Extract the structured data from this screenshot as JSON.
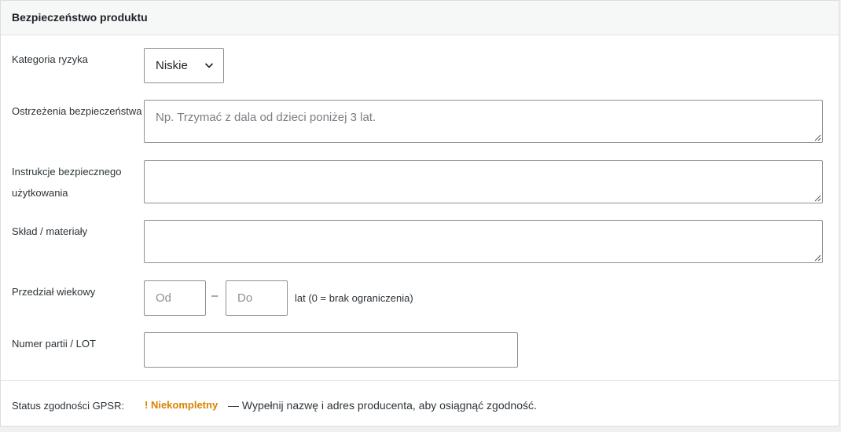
{
  "panel": {
    "title": "Bezpieczeństwo produktu"
  },
  "fields": {
    "risk_category": {
      "label": "Kategoria ryzyka",
      "value": "Niskie",
      "icon": "chevron-down-icon"
    },
    "safety_warnings": {
      "label": "Ostrzeżenia bezpieczeństwa",
      "value": "",
      "placeholder": "Np. Trzymać z dala od dzieci poniżej 3 lat."
    },
    "safe_use_instructions": {
      "label_line1": "Instrukcje bezpiecznego",
      "label_line2": "użytkowania",
      "value": ""
    },
    "composition": {
      "label": "Skład / materiały",
      "value": ""
    },
    "age_range": {
      "label": "Przedział wiekowy",
      "from_placeholder": "Od",
      "to_placeholder": "Do",
      "separator": "–",
      "note": "lat (0 = brak ograniczenia)"
    },
    "batch_number": {
      "label": "Numer partii / LOT",
      "value": ""
    }
  },
  "status": {
    "label": "Status zgodności GPSR:",
    "badge": "! Niekompletny",
    "badge_color": "#d98300",
    "message": "— Wypełnij nazwę i adres producenta, aby osiągnąć zgodność."
  }
}
